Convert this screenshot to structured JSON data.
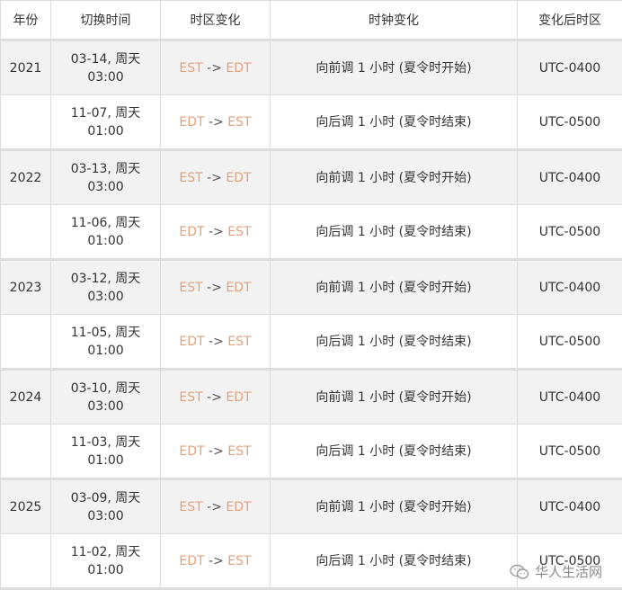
{
  "headers": {
    "year": "年份",
    "switch_time": "切换时间",
    "zone_change": "时区变化",
    "clock_change": "时钟变化",
    "after_zone": "变化后时区"
  },
  "rows": [
    {
      "year": "2021",
      "date": "03-14, 周天",
      "time": "03:00",
      "from": "EST",
      "arrow": "->",
      "to": "EDT",
      "clock": "向前调 1 小时 (夏令时开始)",
      "after": "UTC-0400"
    },
    {
      "year": "",
      "date": "11-07, 周天",
      "time": "01:00",
      "from": "EDT",
      "arrow": "->",
      "to": "EST",
      "clock": "向后调 1 小时 (夏令时结束)",
      "after": "UTC-0500"
    },
    {
      "year": "2022",
      "date": "03-13, 周天",
      "time": "03:00",
      "from": "EST",
      "arrow": "->",
      "to": "EDT",
      "clock": "向前调 1 小时 (夏令时开始)",
      "after": "UTC-0400"
    },
    {
      "year": "",
      "date": "11-06, 周天",
      "time": "01:00",
      "from": "EDT",
      "arrow": "->",
      "to": "EST",
      "clock": "向后调 1 小时 (夏令时结束)",
      "after": "UTC-0500"
    },
    {
      "year": "2023",
      "date": "03-12, 周天",
      "time": "03:00",
      "from": "EST",
      "arrow": "->",
      "to": "EDT",
      "clock": "向前调 1 小时 (夏令时开始)",
      "after": "UTC-0400"
    },
    {
      "year": "",
      "date": "11-05, 周天",
      "time": "01:00",
      "from": "EDT",
      "arrow": "->",
      "to": "EST",
      "clock": "向后调 1 小时 (夏令时结束)",
      "after": "UTC-0500"
    },
    {
      "year": "2024",
      "date": "03-10, 周天",
      "time": "03:00",
      "from": "EST",
      "arrow": "->",
      "to": "EDT",
      "clock": "向前调 1 小时 (夏令时开始)",
      "after": "UTC-0400"
    },
    {
      "year": "",
      "date": "11-03, 周天",
      "time": "01:00",
      "from": "EDT",
      "arrow": "->",
      "to": "EST",
      "clock": "向后调 1 小时 (夏令时结束)",
      "after": "UTC-0500"
    },
    {
      "year": "2025",
      "date": "03-09, 周天",
      "time": "03:00",
      "from": "EST",
      "arrow": "->",
      "to": "EDT",
      "clock": "向前调 1 小时 (夏令时开始)",
      "after": "UTC-0400"
    },
    {
      "year": "",
      "date": "11-02, 周天",
      "time": "01:00",
      "from": "EDT",
      "arrow": "->",
      "to": "EST",
      "clock": "向后调 1 小时 (夏令时结束)",
      "after": "UTC-0500"
    }
  ],
  "watermark": {
    "text": "华人生活网",
    "icon": "wechat-icon"
  },
  "colors": {
    "zone_text": "#e2a27c",
    "row_shade": "#f2f2f2",
    "border": "#dddddd"
  }
}
